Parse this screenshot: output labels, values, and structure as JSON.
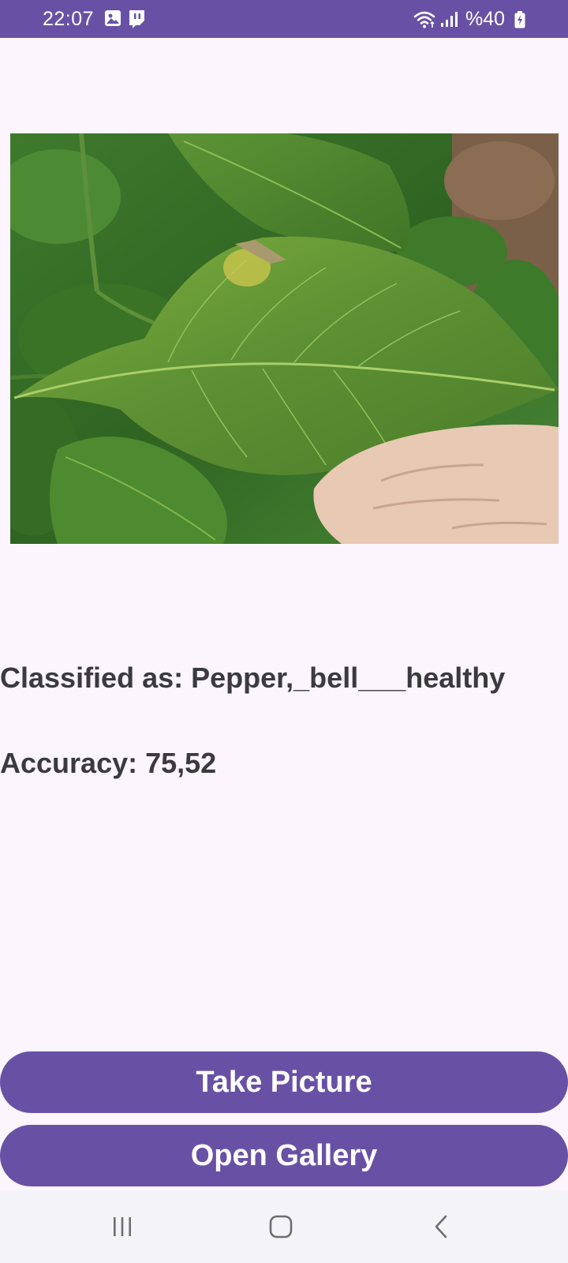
{
  "status_bar": {
    "time": "22:07",
    "battery_text": "%40",
    "icons": [
      "gallery-notification-icon",
      "twitch-notification-icon",
      "wifi-icon",
      "signal-icon",
      "battery-charging-icon"
    ]
  },
  "photo": {
    "subject": "pepper-leaf-photo"
  },
  "result": {
    "classified_label": "Classified as: Pepper,_bell___healthy",
    "accuracy_label": "Accuracy: 75,52"
  },
  "buttons": {
    "take_picture": "Take Picture",
    "open_gallery": "Open Gallery"
  },
  "nav_bar": {
    "items": [
      "recent-apps-icon",
      "home-icon",
      "back-icon"
    ]
  },
  "colors": {
    "primary": "#6851a5",
    "background": "#fcf5fd",
    "text": "#3a3a3f",
    "nav_bar": "#f4f3f7"
  }
}
